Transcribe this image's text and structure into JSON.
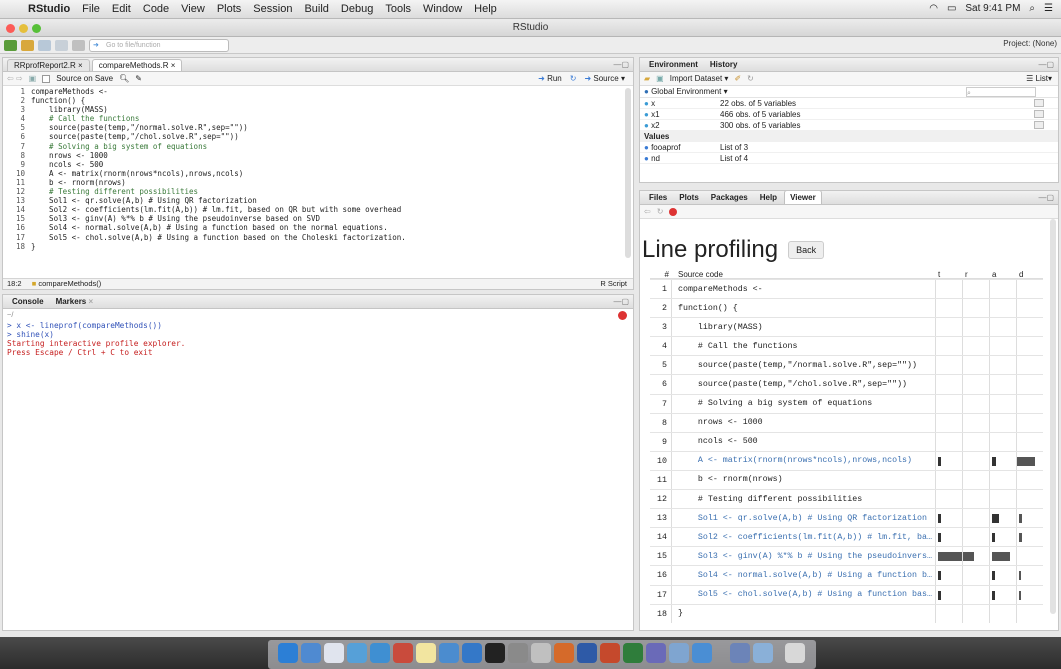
{
  "menubar": {
    "apple": "",
    "app": "RStudio",
    "items": [
      "File",
      "Edit",
      "Code",
      "View",
      "Plots",
      "Session",
      "Build",
      "Debug",
      "Tools",
      "Window",
      "Help"
    ],
    "clock": "Sat 9:41 PM"
  },
  "window": {
    "title": "RStudio"
  },
  "toolbar": {
    "goto_placeholder": "Go to file/function",
    "project": "Project: (None)"
  },
  "editor": {
    "tabs": [
      "RRprofReport2.R",
      "compareMethods.R"
    ],
    "source_on_save": "Source on Save",
    "run": "Run",
    "source": "Source",
    "lines": [
      "compareMethods <-",
      "function() {",
      "    library(MASS)",
      "    # Call the functions",
      "    source(paste(temp,\"/normal.solve.R\",sep=\"\"))",
      "    source(paste(temp,\"/chol.solve.R\",sep=\"\"))",
      "    # Solving a big system of equations",
      "    nrows <- 1000",
      "    ncols <- 500",
      "    A <- matrix(rnorm(nrows*ncols),nrows,ncols)",
      "    b <- rnorm(nrows)",
      "    # Testing different possibilities",
      "    Sol1 <- qr.solve(A,b) # Using QR factorization",
      "    Sol2 <- coefficients(lm.fit(A,b)) # lm.fit, based on QR but with some overhead",
      "    Sol3 <- ginv(A) %*% b # Using the pseudoinverse based on SVD",
      "    Sol4 <- normal.solve(A,b) # Using a function based on the normal equations.",
      "    Sol5 <- chol.solve(A,b) # Using a function based on the Choleski factorization.",
      "}"
    ],
    "status_pos": "18:2",
    "status_fn": "compareMethods()",
    "status_type": "R Script"
  },
  "console": {
    "tabs": [
      "Console",
      "Markers"
    ],
    "path": "~/",
    "lines": [
      {
        "text": "> x <- lineprof(compareMethods())",
        "cls": "blue"
      },
      {
        "text": "> shine(x)",
        "cls": "blue"
      },
      {
        "text": "Starting interactive profile explorer.",
        "cls": "red"
      },
      {
        "text": "Press Escape / Ctrl + C to exit",
        "cls": "red"
      }
    ]
  },
  "environment": {
    "tabs": [
      "Environment",
      "History"
    ],
    "import": "Import Dataset",
    "scope": "Global Environment",
    "list_label": "List",
    "rows": [
      {
        "name": "x",
        "value": "22 obs. of 5 variables"
      },
      {
        "name": "x1",
        "value": "466 obs. of 5 variables"
      },
      {
        "name": "x2",
        "value": "300 obs. of 5 variables"
      }
    ],
    "values_header": "Values",
    "values": [
      {
        "name": "fooaprof",
        "value": "List of 3"
      },
      {
        "name": "nd",
        "value": "List of 4"
      }
    ]
  },
  "viewer": {
    "tabs": [
      "Files",
      "Plots",
      "Packages",
      "Help",
      "Viewer"
    ],
    "heading": "Line profiling",
    "back": "Back",
    "col_source": "Source code",
    "cols": [
      "t",
      "r",
      "a",
      "d"
    ],
    "rows": [
      {
        "n": "1",
        "code": "compareMethods <-",
        "hl": false
      },
      {
        "n": "2",
        "code": "function() {",
        "hl": false
      },
      {
        "n": "3",
        "code": "    library(MASS)",
        "hl": false
      },
      {
        "n": "4",
        "code": "    # Call the functions",
        "hl": false
      },
      {
        "n": "5",
        "code": "    source(paste(temp,\"/normal.solve.R\",sep=\"\"))",
        "hl": false
      },
      {
        "n": "6",
        "code": "    source(paste(temp,\"/chol.solve.R\",sep=\"\"))",
        "hl": false
      },
      {
        "n": "7",
        "code": "    # Solving a big system of equations",
        "hl": false
      },
      {
        "n": "8",
        "code": "    nrows <- 1000",
        "hl": false
      },
      {
        "n": "9",
        "code": "    ncols <- 500",
        "hl": false
      },
      {
        "n": "10",
        "code": "    A <- matrix(rnorm(nrows*ncols),nrows,ncols)",
        "hl": true
      },
      {
        "n": "11",
        "code": "    b <- rnorm(nrows)",
        "hl": false
      },
      {
        "n": "12",
        "code": "    # Testing different possibilities",
        "hl": false
      },
      {
        "n": "13",
        "code": "    Sol1 <- qr.solve(A,b) # Using QR factorization",
        "hl": true
      },
      {
        "n": "14",
        "code": "    Sol2 <- coefficients(lm.fit(A,b)) # lm.fit, ba…",
        "hl": true
      },
      {
        "n": "15",
        "code": "    Sol3 <- ginv(A) %*% b # Using the pseudoinvers…",
        "hl": true
      },
      {
        "n": "16",
        "code": "    Sol4 <- normal.solve(A,b) # Using a function b…",
        "hl": true
      },
      {
        "n": "17",
        "code": "    Sol5 <- chol.solve(A,b) # Using a function bas…",
        "hl": true
      },
      {
        "n": "18",
        "code": "}",
        "hl": false
      }
    ]
  }
}
